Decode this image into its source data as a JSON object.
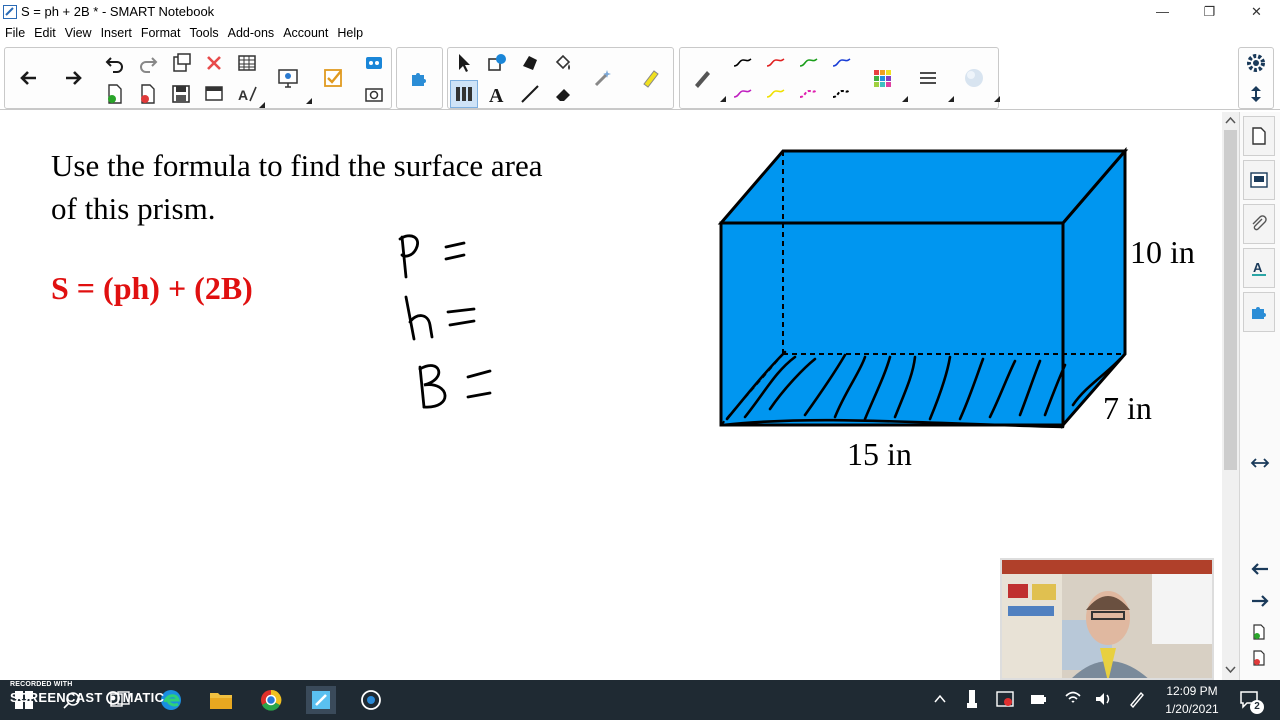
{
  "window": {
    "title": "S = ph + 2B * - SMART Notebook",
    "min_symbol": "—",
    "max_symbol": "❐",
    "close_symbol": "✕"
  },
  "menu": [
    "File",
    "Edit",
    "View",
    "Insert",
    "Format",
    "Tools",
    "Add-ons",
    "Account",
    "Help"
  ],
  "toolbar": {
    "icons": [
      "back-arrow-icon",
      "forward-arrow-icon",
      "undo-icon",
      "redo-icon",
      "paste-icon",
      "delete-icon",
      "table-icon",
      "add-page-icon",
      "delete-page-icon",
      "save-icon",
      "screen-shade-icon",
      "handwriting-icon",
      "display-icon",
      "capture-icon",
      "response-icon",
      "addons-icon",
      "select-icon",
      "shapes-icon",
      "fill-icon",
      "magic-pen-icon",
      "highlighter-icon",
      "text-icon",
      "line-icon",
      "eraser-icon",
      "pen-icon",
      "color-palette-icon",
      "line-style-icon",
      "fill-effects-icon",
      "settings-icon"
    ],
    "pen_colors": [
      "#000000",
      "#e02020",
      "#1a9e1a",
      "#1a3ed6",
      "#c020c0",
      "#f0e000",
      "#e020b0",
      "#000000"
    ]
  },
  "canvas": {
    "question_line1": "Use the formula to find the surface area",
    "question_line2": "of this prism.",
    "formula": "S = (ph) + (2B)",
    "formula_color": "#e01010",
    "dim_height": "10 in",
    "dim_depth": "7 in",
    "dim_length": "15 in",
    "prism_color": "#0096f0",
    "handwritten": [
      "P =",
      "h =",
      "B ="
    ]
  },
  "taskbar": {
    "recorded_with": "RECORDED WITH",
    "brand": "SCREENCAST",
    "brand2": "MATIC",
    "time": "12:09 PM",
    "date": "1/20/2021",
    "notification_count": "2"
  }
}
